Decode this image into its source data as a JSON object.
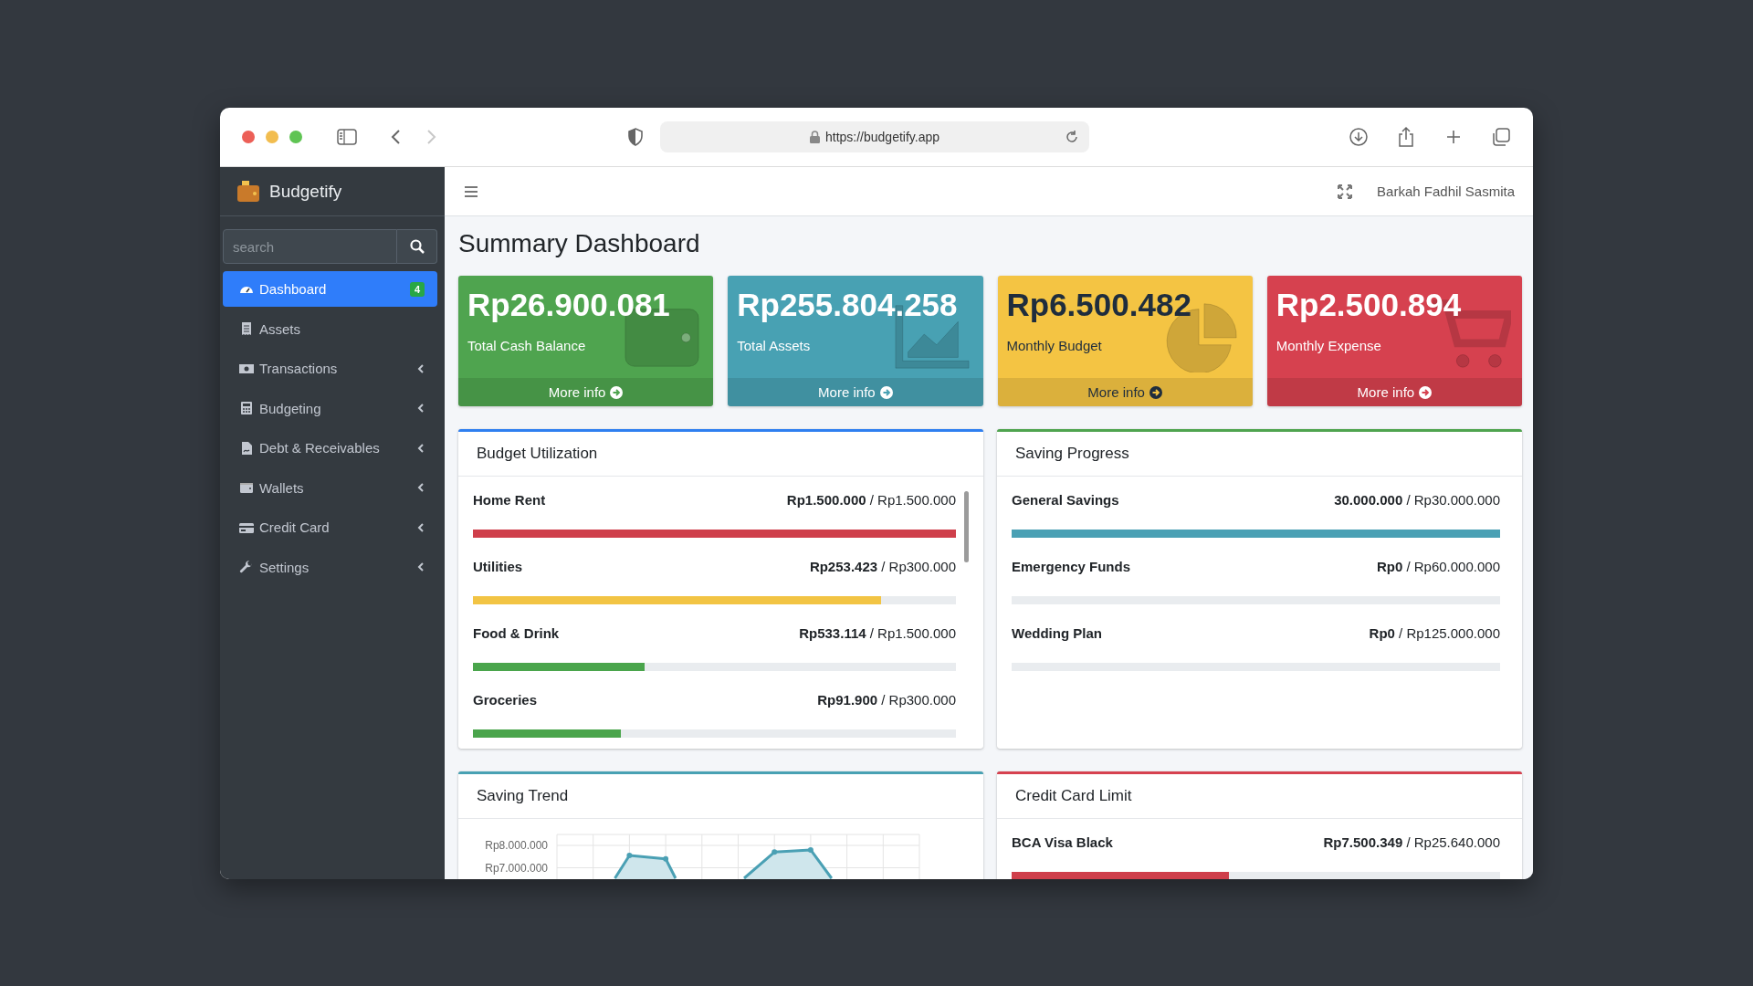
{
  "browser": {
    "url": "https://budgetify.app",
    "back_disabled": false,
    "forward_disabled": true
  },
  "sidebar": {
    "brand": "Budgetify",
    "search": {
      "placeholder": "search"
    },
    "items": [
      {
        "label": "Dashboard",
        "selected": true,
        "expandable": false,
        "badge": "4"
      },
      {
        "label": "Assets",
        "selected": false,
        "expandable": false
      },
      {
        "label": "Transactions",
        "selected": false,
        "expandable": true
      },
      {
        "label": "Budgeting",
        "selected": false,
        "expandable": true
      },
      {
        "label": "Debt & Receivables",
        "selected": false,
        "expandable": true
      },
      {
        "label": "Wallets",
        "selected": false,
        "expandable": true
      },
      {
        "label": "Credit Card",
        "selected": false,
        "expandable": true
      },
      {
        "label": "Settings",
        "selected": false,
        "expandable": true
      }
    ]
  },
  "navbar": {
    "user": "Barkah Fadhil Sasmita"
  },
  "page_title": "Summary Dashboard",
  "stat_cards": [
    {
      "value": "Rp26.900.081",
      "label": "Total Cash Balance",
      "link": "More info",
      "color": "#4fa44f"
    },
    {
      "value": "Rp255.804.258",
      "label": "Total Assets",
      "link": "More info",
      "color": "#48a1b3"
    },
    {
      "value": "Rp6.500.482",
      "label": "Monthly Budget",
      "link": "More info",
      "color": "#f4c443"
    },
    {
      "value": "Rp2.500.894",
      "label": "Monthly Expense",
      "link": "More info",
      "color": "#d6414f"
    }
  ],
  "panels": [
    {
      "kind": "progress",
      "title": "Budget Utilization",
      "color": "#2f7ff0",
      "scrollable": true,
      "rows": [
        {
          "name": "Home Rent",
          "value": "**Rp1.500.000** / Rp1.500.000",
          "level": 1.0,
          "color": "#cf3f4b"
        },
        {
          "name": "Utilities",
          "value": "**Rp253.423** / Rp300.000",
          "level": 0.845,
          "color": "#f2c444"
        },
        {
          "name": "Food & Drink",
          "value": "**Rp533.114** / Rp1.500.000",
          "level": 0.355,
          "color": "#4aa54c"
        },
        {
          "name": "Groceries",
          "value": "**Rp91.900** / Rp300.000",
          "level": 0.306,
          "color": "#4aa54c"
        }
      ]
    },
    {
      "kind": "progress",
      "title": "Saving Progress",
      "color": "#4fa44f",
      "rows": [
        {
          "name": "General Savings",
          "value": "**30.000.000** / Rp30.000.000",
          "level": 1.0,
          "color": "#4aa0b4"
        },
        {
          "name": "Emergency Funds",
          "value": "**Rp0** / Rp60.000.000",
          "level": 0
        },
        {
          "name": "Wedding Plan",
          "value": "**Rp0** / Rp125.000.000",
          "level": 0
        }
      ]
    },
    {
      "kind": "chart",
      "title": "Saving Trend",
      "color": "#48a1b3",
      "y_labels": [
        "Rp8.000.000",
        "Rp7.000.000"
      ]
    },
    {
      "kind": "progress",
      "title": "Credit Card Limit",
      "color": "#d6414f",
      "rows": [
        {
          "name": "BCA Visa Black",
          "value": "**Rp7.500.349** / Rp25.640.000",
          "level": 0.445,
          "color": "#cf3f4b"
        }
      ]
    }
  ]
}
